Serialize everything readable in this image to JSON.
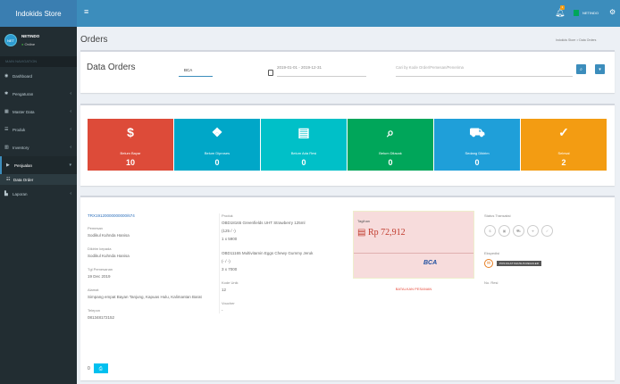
{
  "app": {
    "brand": "Indokids Store",
    "user_name": "NETINDO",
    "status_label": "Online",
    "notif_count": "1"
  },
  "sidebar": {
    "header": "MAIN NAVIGATION",
    "items": [
      {
        "label": "Dashboard",
        "icon": "dashboard-icon"
      },
      {
        "label": "Pengaturan",
        "icon": "cog-icon"
      },
      {
        "label": "Master Data",
        "icon": "database-icon"
      },
      {
        "label": "Produk",
        "icon": "list-icon"
      },
      {
        "label": "Inventory",
        "icon": "cube-icon"
      },
      {
        "label": "Penjualan",
        "icon": "cart-icon"
      },
      {
        "label": "Laporan",
        "icon": "chart-icon"
      }
    ],
    "sub_item": "Data Order"
  },
  "page": {
    "title": "Orders",
    "breadcrumb": "Indokids Store > Data Orders"
  },
  "filter": {
    "title": "Data Orders",
    "bank_value": "BCA",
    "date_range": "2019-01-01 - 2019-12-31",
    "search_placeholder": "Cari by Kode Order/Pemesan/Penerima"
  },
  "tiles": [
    {
      "label": "Belum Bayar",
      "value": "10",
      "color": "#dd4b39",
      "icon": "$"
    },
    {
      "label": "Belum Diproses",
      "value": "0",
      "color": "#00a7c8",
      "icon": "❖"
    },
    {
      "label": "Belum Ada Resi",
      "value": "0",
      "color": "#00c0c8",
      "icon": "▤"
    },
    {
      "label": "Belum Dilacak",
      "value": "0",
      "color": "#00a65a",
      "icon": "⌕"
    },
    {
      "label": "Sedang Dikirim",
      "value": "0",
      "color": "#1f9fd9",
      "icon": "⛟"
    },
    {
      "label": "Selesai",
      "value": "2",
      "color": "#f39c12",
      "icon": "✓"
    }
  ],
  "order": {
    "id": "TRX19120000000000/674",
    "pemesan_label": "Pemesan",
    "pemesan": "Sodikul Kuhnda Hanisa",
    "dikirim_label": "Dikirim kepada",
    "dikirim": "Sodikul Kuhnda Hanisa",
    "tgl_label": "Tgl Pemesanan",
    "tgl": "19 Dec 2019",
    "alamat_label": "Alamat",
    "alamat": "Simpang empat Bayan Tanjung, Kapuas Hulu, Kalimantan Barat",
    "telepon_label": "Telepon",
    "telepon": "081348172152",
    "produk_label": "Produk",
    "produk1": "OBD18165 Greenfields UHT Strawberry 125ml",
    "produk1_qty": "(125 / -)",
    "produk1_total": "1 x 5900",
    "produk2": "OBD11165 Multivitamin Eggs Chewy Gummy Jeruk",
    "produk2_qty": "(- / -)",
    "produk2_total": "3 x 7000",
    "kode_unik_label": "Kode Unik",
    "kode_unik": "12",
    "voucher_label": "Voucher",
    "voucher": "-",
    "tagihan_label": "Tagihan",
    "tagihan": "Rp 72,912",
    "bank": "BCA",
    "batalkan": "BATALKAN PESANAN",
    "status_label": "Status Transaksi",
    "ekspedisi_label": "Ekspedisi",
    "ekspedisi_badge": "POS KILAT KHUSUS REGULER",
    "no_resi_label": "No. Resi",
    "pager_text": "0"
  }
}
